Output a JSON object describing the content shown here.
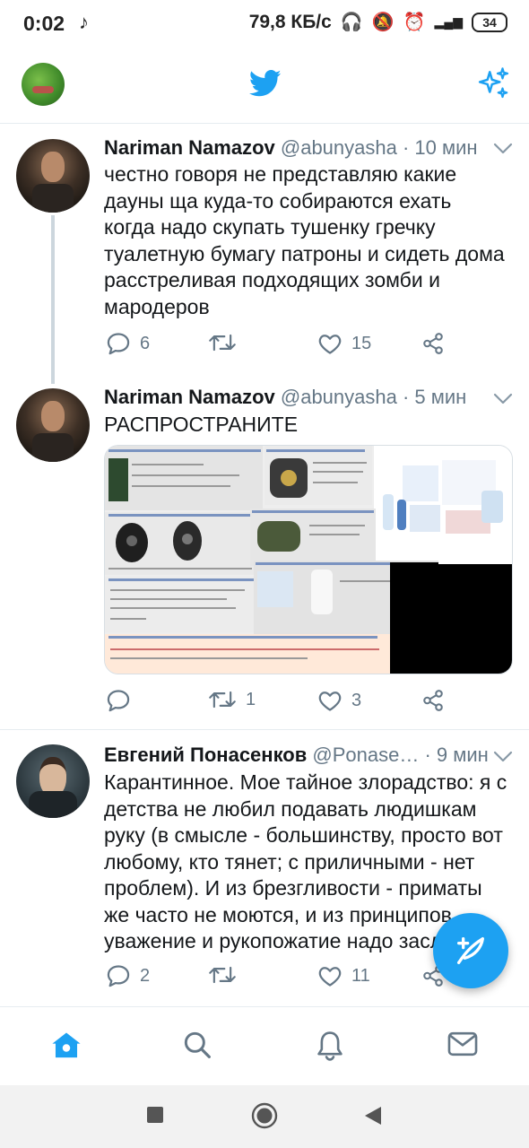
{
  "status_bar": {
    "time": "0:02",
    "network_speed": "79,8 КБ/с",
    "battery": "34"
  },
  "header": {
    "logo_icon": "twitter-bird-icon",
    "accent_color": "#1da1f2"
  },
  "tweets": [
    {
      "name": "Nariman Namazov",
      "handle": "@abunyasha",
      "time": "· 10 мин",
      "text": "честно говоря не представляю какие дауны ща куда-то собираются ехать когда надо скупать тушенку гречку туалетную бумагу патроны и сидеть дома расстреливая подходящих зомби и мародеров",
      "replies": "6",
      "retweets": "",
      "likes": "15"
    },
    {
      "name": "Nariman Namazov",
      "handle": "@abunyasha",
      "time": "· 5 мин",
      "text": "РАСПРОСТРАНИТЕ",
      "replies": "",
      "retweets": "1",
      "likes": "3"
    },
    {
      "name": "Евгений Понасенков",
      "handle": "@Ponase…",
      "time": "· 9 мин",
      "text": "Карантинное. Мое тайное злорадство: я с детства не любил подавать людишкам руку (в смысле - большинству, просто вот любому, кто тянет; с приличными - нет проблем). И из брезгливости - приматы же часто не моются, и из принципов - уважение и рукопожатие надо засл",
      "replies": "2",
      "retweets": "",
      "likes": "11"
    }
  ]
}
